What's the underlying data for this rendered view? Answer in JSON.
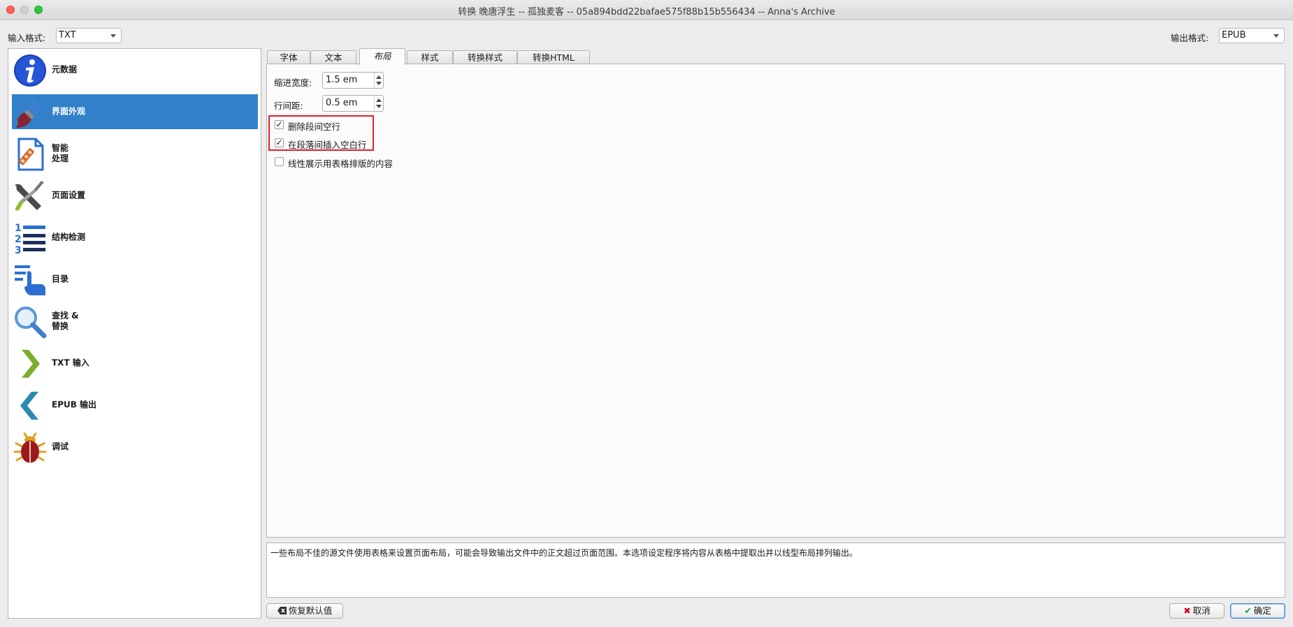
{
  "window": {
    "title": "转换 晚唐浮生 -- 孤独麦客 -- 05a894bdd22bafae575f88b15b556434 -- Anna's Archive"
  },
  "input_format": {
    "label": "输入格式:",
    "value": "TXT"
  },
  "output_format": {
    "label": "输出格式:",
    "value": "EPUB"
  },
  "sidebar": {
    "items": [
      {
        "label": "元数据",
        "icon": "info-icon"
      },
      {
        "label": "界面外观",
        "icon": "paintbrush-icon"
      },
      {
        "label": "智能\n处理",
        "icon": "document-wand-icon"
      },
      {
        "label": "页面设置",
        "icon": "wrench-screwdriver-icon"
      },
      {
        "label": "结构检测",
        "icon": "numbered-list-icon"
      },
      {
        "label": "目录",
        "icon": "toc-hand-icon"
      },
      {
        "label": "查找 &\n替换",
        "icon": "magnifier-icon"
      },
      {
        "label": "TXT 输入",
        "icon": "chevron-right-icon"
      },
      {
        "label": "EPUB 输出",
        "icon": "chevron-left-icon"
      },
      {
        "label": "调试",
        "icon": "bug-icon"
      }
    ],
    "selected_index": 1
  },
  "tabs": [
    {
      "label": "字体"
    },
    {
      "label": "文本"
    },
    {
      "label": "布局"
    },
    {
      "label": "样式"
    },
    {
      "label": "转换样式"
    },
    {
      "label": "转换HTML"
    }
  ],
  "active_tab": 2,
  "layout": {
    "indent": {
      "label": "缩进宽度:",
      "value": "1.5 em"
    },
    "line_spacing": {
      "label": "行间距:",
      "value": "0.5 em"
    },
    "checkboxes": [
      {
        "label": "删除段间空行",
        "checked": true,
        "mark": "✓"
      },
      {
        "label": "在段落间插入空白行",
        "checked": true,
        "mark": "✓"
      },
      {
        "label": "线性展示用表格排版的内容",
        "checked": false,
        "mark": ""
      }
    ]
  },
  "help_text": "一些布局不佳的源文件使用表格来设置页面布局，可能会导致输出文件中的正文超过页面范围。本选项设定程序将内容从表格中提取出并以线型布局排列输出。",
  "buttons": {
    "restore": "恢复默认值",
    "cancel": "取消",
    "ok": "确定"
  },
  "colors": {
    "selection": "#3280c9",
    "highlight_border": "#e0202a",
    "cancel_x": "#d0021b",
    "ok_check": "#1e9e3a"
  }
}
